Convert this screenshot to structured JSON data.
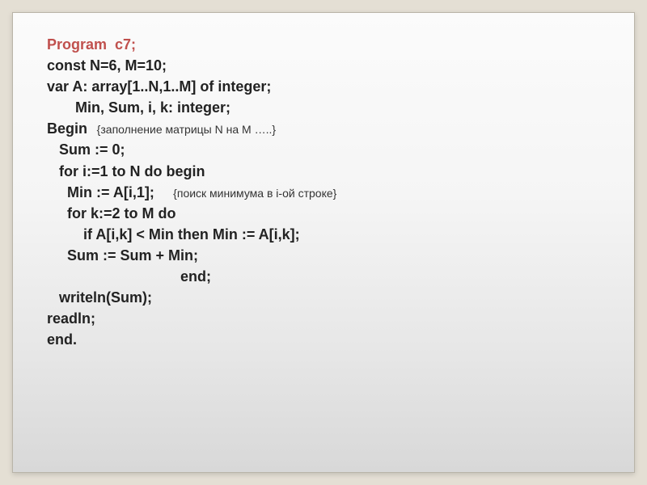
{
  "code": {
    "l1_prog": "Program  c7;",
    "l2": "const N=6, M=10;",
    "l3": "var A: array[1..N,1..M] of integer;",
    "l4": "       Min, Sum, i, k: integer;",
    "l5_begin": "Begin",
    "l5_comment": "   {заполнение матрицы N на M …..}",
    "l6": "   Sum := 0;",
    "l7": "   for i:=1 to N do begin",
    "l8a": "     Min := A[i,1];",
    "l8_comment": "      {поиск минимума в i-ой строке}",
    "l9": "     for k:=2 to M do",
    "l10": "         if A[i,k] < Min then Min := A[i,k];",
    "l11": "     Sum := Sum + Min;",
    "l12": "                                 end;",
    "l13": "   writeln(Sum);",
    "l14": "readln;",
    "l15": "end."
  }
}
